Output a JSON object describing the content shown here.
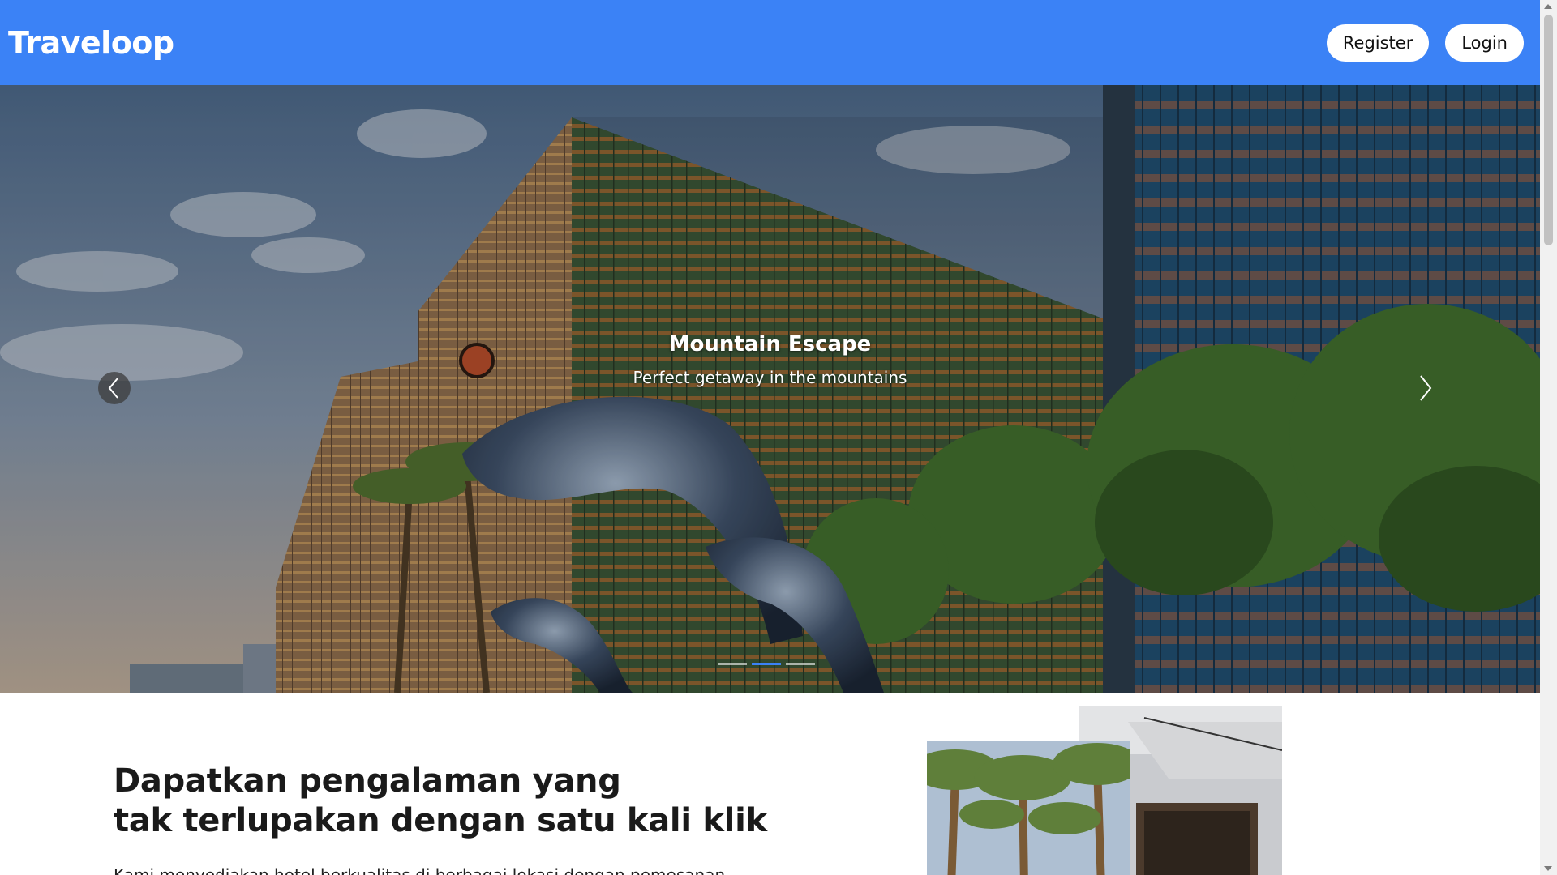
{
  "header": {
    "brand": "Traveloop",
    "register_label": "Register",
    "login_label": "Login"
  },
  "carousel": {
    "slide_title": "Mountain Escape",
    "slide_subtitle": "Perfect getaway in the mountains",
    "active_index": 1,
    "slide_count": 3,
    "image_description": "hotel-skyscraper-dolphin-sculpture",
    "prev_icon": "chevron-left-icon",
    "next_icon": "chevron-right-icon"
  },
  "intro": {
    "heading_line1": "Dapatkan pengalaman yang",
    "heading_line2": "tak terlupakan dengan satu kali klik",
    "paragraph": "Kami menyediakan hotel berkualitas di berbagai lokasi dengan pemesanan"
  },
  "gallery": {
    "front_image": "palm-trees-photo",
    "back_image": "hotel-interior-photo"
  },
  "colors": {
    "brand_blue": "#3b82f6",
    "header_text": "#ffffff",
    "heading_text": "#1a1a1a"
  }
}
